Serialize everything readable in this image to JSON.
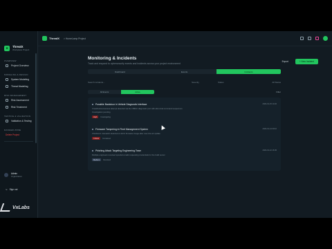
{
  "sidebar": {
    "brand_name": "ThreatX",
    "brand_sub": "Workplace Project",
    "sections": [
      {
        "title": "OVERVIEW",
        "items": [
          {
            "label": "Project Overview"
          }
        ]
      },
      {
        "title": "MODELING & DESIGN",
        "items": [
          {
            "label": "System Modeling"
          },
          {
            "label": "Threat Modeling"
          }
        ]
      },
      {
        "title": "RISK MANAGEMENT",
        "items": [
          {
            "label": "Risk Assessment"
          },
          {
            "label": "Risk Treatment"
          }
        ]
      },
      {
        "title": "TESTING & VALIDATION",
        "items": [
          {
            "label": "Validation & Testing"
          }
        ]
      },
      {
        "title": "DANGER ZONE",
        "items": []
      }
    ],
    "danger_label": "Delete Project",
    "user_name": "Admin",
    "user_role": "Organization",
    "signout": "Sign out"
  },
  "topbar": {
    "name": "ThreatX",
    "crumb": "> HumeLamp Project"
  },
  "page": {
    "title": "Monitoring & Incidents",
    "subtitle": "Track and respond to cybersecurity events and incidents across your project environment",
    "export": "Export",
    "new_button": "+ New Incident"
  },
  "tabs": [
    {
      "label": "Dashboard",
      "active": false
    },
    {
      "label": "Events",
      "active": false
    },
    {
      "label": "Incidents",
      "active": true
    }
  ],
  "filters": {
    "search": "Search incidents...",
    "col1": "Severity",
    "col2": "Status",
    "col3": "All Status"
  },
  "segments": [
    {
      "label": "All Events",
      "active": false
    },
    {
      "label": "Active",
      "active": true
    }
  ],
  "seg_action": "Filter",
  "incidents": [
    {
      "title": "Possible Backdoor in Vehicle Diagnostic Interface",
      "desc": "Unauthorized access attempt detected via the OBD-II diagnostic port with abnormal command sequences",
      "desc2": "Investigation pending",
      "badge": "High",
      "badge_color": "red",
      "meta": "Investigating",
      "date": "2024-01-15 14:32"
    },
    {
      "title": "Firmware Tampering in Fleet Management System",
      "desc": "Checksum mismatch detected on ECU firmware image after over-the-air update",
      "desc2": "",
      "badge": "Critical",
      "badge_color": "red",
      "meta": "Contained",
      "date": "2024-01-14 09:10"
    },
    {
      "title": "Phishing Attack Targeting Engineering Team",
      "desc": "Multiple engineers received spoofed emails requesting credentials for the build server",
      "desc2": "",
      "badge": "Medium",
      "badge_color": "gray",
      "meta": "Resolved",
      "date": "2024-01-12 16:45"
    }
  ],
  "watermark": "VxLabs"
}
